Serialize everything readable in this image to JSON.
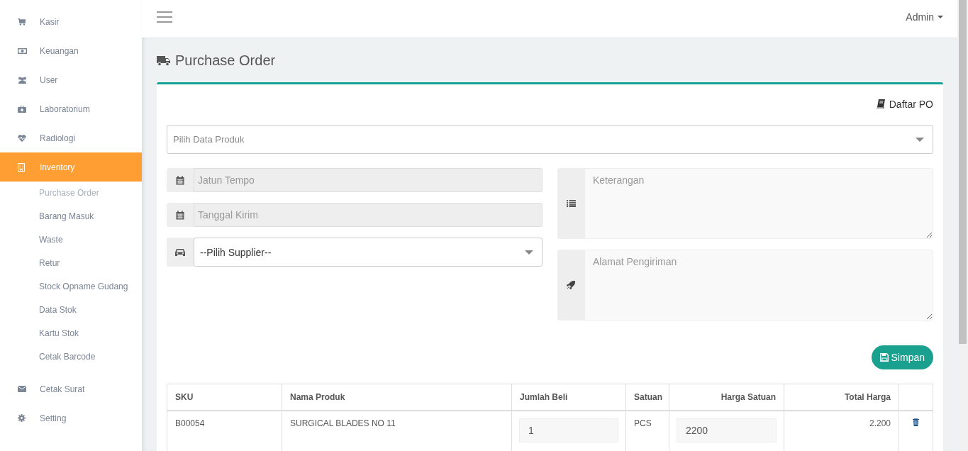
{
  "sidebar": {
    "items": [
      {
        "label": "Kasir",
        "selected": false
      },
      {
        "label": "Keuangan",
        "selected": false
      },
      {
        "label": "User",
        "selected": false
      },
      {
        "label": "Laboratorium",
        "selected": false
      },
      {
        "label": "Radiologi",
        "selected": false
      },
      {
        "label": "Inventory",
        "selected": true,
        "children": [
          {
            "label": "Purchase Order",
            "selected": true
          },
          {
            "label": "Barang Masuk",
            "selected": false
          },
          {
            "label": "Waste",
            "selected": false
          },
          {
            "label": "Retur",
            "selected": false
          },
          {
            "label": "Stock Opname Gudang",
            "selected": false
          },
          {
            "label": "Data Stok",
            "selected": false
          },
          {
            "label": "Kartu Stok",
            "selected": false
          },
          {
            "label": "Cetak Barcode",
            "selected": false
          }
        ]
      },
      {
        "label": "Cetak Surat",
        "selected": false
      },
      {
        "label": "Setting",
        "selected": false
      }
    ]
  },
  "topbar": {
    "user": "Admin"
  },
  "page": {
    "title": "Purchase Order",
    "list_link": "Daftar PO",
    "product_select": {
      "placeholder": "Pilih Data Produk"
    },
    "left_fields": [
      {
        "kind": "date",
        "placeholder": "Jatun Tempo"
      },
      {
        "kind": "date",
        "placeholder": "Tanggal Kirim"
      },
      {
        "kind": "select",
        "value": "--Pilih Supplier--"
      }
    ],
    "right_fields": [
      {
        "kind": "notes",
        "placeholder": "Keterangan"
      },
      {
        "kind": "address",
        "placeholder": "Alamat Pengiriman"
      }
    ],
    "save_button": "Simpan",
    "table": {
      "columns": [
        {
          "label": "SKU"
        },
        {
          "label": "Nama Produk"
        },
        {
          "label": "Jumlah Beli"
        },
        {
          "label": "Satuan"
        },
        {
          "label": "Harga Satuan"
        },
        {
          "label": "Total Harga"
        }
      ],
      "rows": [
        {
          "sku": "B00054",
          "name": "SURGICAL BLADES NO 11",
          "qty": "1",
          "unit": "PCS",
          "price": "2200",
          "total": "2.200"
        }
      ]
    }
  }
}
